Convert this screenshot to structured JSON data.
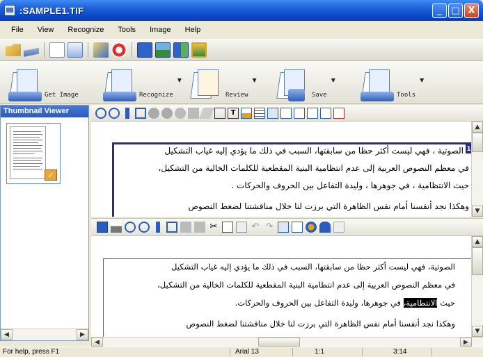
{
  "window": {
    "title": ":SAMPLE1.TIF",
    "buttons": [
      "_",
      "□",
      "X"
    ]
  },
  "menu": [
    "File",
    "View",
    "Recognize",
    "Tools",
    "Image",
    "Help"
  ],
  "main_toolbar": {
    "buttons": [
      "Get Image",
      "Recognize",
      "Review",
      "Save",
      "Tools"
    ]
  },
  "thumbnail_viewer": {
    "title": "Thumbnail Viewer"
  },
  "image_view": {
    "zone_number": "1",
    "lines": [
      "الصوتية ، فهي ليست أكثر حظا من سابقتها، السبب في ذلك ما يؤدي إليه غياب التشكيل",
      "في معظم النصوص العربية إلى عدم انتظامية البنية المقطعية للكلمات الخالية من التشكيل،",
      "حيث الانتظامية ، في جوهرها ، وليدة التفاعل بين الحروف والحركات .",
      "وهكذا نجد أنفسنا أمام نفس الظاهرة التي برزت لنا خلال مناقشتنا لضغط النصوص"
    ]
  },
  "text_view": {
    "lines": [
      "الصوتية، فهي ليست أكثر حظا من سابقتها، السبب في ذلك ما يؤدي إليه غياب التشكيل",
      "في معظم النصوص العربية إلى عدم انتظامية البنية المقطعية للكلمات الخالية من التشكيل،",
      "في جوهرها، وليدة التفاعل بين الحروف والحركات.",
      "وهكذا نجد أنفسنا أمام نفس الظاهرة التي برزت لنا خلال مناقشتنا لضغط النصوص"
    ],
    "line3_prefix": "حيث",
    "highlight_word": "الانتظامية،"
  },
  "status": {
    "help": "For help, press F1",
    "font": "Arial 13",
    "zoom": "1:1",
    "position": "3:14"
  },
  "colors": {
    "title_bar": "#0a46c8",
    "zone_border": "#2a2a8a"
  }
}
